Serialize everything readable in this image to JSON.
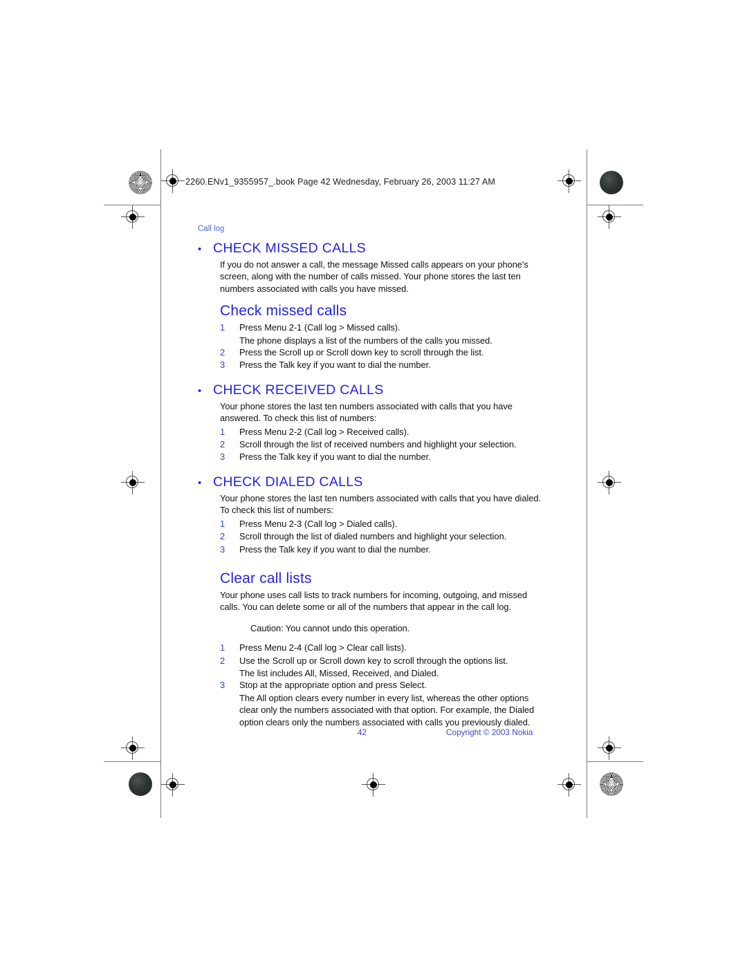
{
  "page": {
    "print_header": "2260.ENv1_9355957_.book  Page 42  Wednesday, February 26, 2003  11:27 AM",
    "running_head": "Call log",
    "bullet_glyph": "•"
  },
  "sections": [
    {
      "id": "check-missed-calls",
      "heading": "CHECK MISSED CALLS",
      "intro": [
        "If you do not answer a call, the message Missed calls appears on your phone's screen, along with the number of calls missed. Your phone stores the last ten numbers associated with calls you have missed."
      ],
      "subheading": "Check missed calls",
      "steps": [
        {
          "num": "1",
          "text": "Press Menu 2-1 (Call log > Missed calls).",
          "note": "The phone displays a list of the numbers of the calls you missed."
        },
        {
          "num": "2",
          "text": "Press the Scroll up or Scroll down key to scroll through the list.",
          "note": ""
        },
        {
          "num": "3",
          "text": "Press the Talk key if you want to dial the number.",
          "note": ""
        }
      ]
    },
    {
      "id": "check-received-calls",
      "heading": "CHECK RECEIVED CALLS",
      "intro": [
        "Your phone stores the last ten numbers associated with calls that you have answered. To check this list of numbers:"
      ],
      "subheading": "",
      "steps": [
        {
          "num": "1",
          "text": "Press Menu 2-2 (Call log > Received calls).",
          "note": ""
        },
        {
          "num": "2",
          "text": "Scroll through the list of received numbers and highlight your selection.",
          "note": ""
        },
        {
          "num": "3",
          "text": "Press the Talk key if you want to dial the number.",
          "note": ""
        }
      ]
    },
    {
      "id": "check-dialed-calls",
      "heading": "CHECK DIALED CALLS",
      "intro": [
        "Your phone stores the last ten numbers associated with calls that you have dialed. To check this list of numbers:"
      ],
      "subheading": "",
      "steps": [
        {
          "num": "1",
          "text": "Press Menu 2-3 (Call log > Dialed calls).",
          "note": ""
        },
        {
          "num": "2",
          "text": "Scroll through the list of dialed numbers and highlight your selection.",
          "note": ""
        },
        {
          "num": "3",
          "text": "Press the Talk key if you want to dial the number.",
          "note": ""
        }
      ]
    }
  ],
  "clear_call_lists": {
    "subheading": "Clear call lists",
    "intro": "Your phone uses call lists to track numbers for incoming, outgoing, and missed calls. You can delete some or all of the numbers that appear in the call log.",
    "caution": "Caution: You cannot undo this operation.",
    "steps": [
      {
        "num": "1",
        "text": "Press Menu 2-4 (Call log > Clear call lists).",
        "note": ""
      },
      {
        "num": "2",
        "text": "Use the Scroll up or Scroll down key to scroll through the options list.",
        "note": "The list includes All, Missed, Received, and Dialed."
      },
      {
        "num": "3",
        "text": "Stop at the appropriate option and press Select.",
        "note": "The All option clears every number in every list, whereas the other options clear only the numbers associated with that option. For example, the Dialed option clears only the numbers associated with calls you previously dialed."
      }
    ]
  },
  "footer": {
    "page_number": "42",
    "copyright": "Copyright © 2003 Nokia"
  },
  "colors": {
    "heading_blue": "#2323e0",
    "running_head_blue": "#5262d8",
    "step_number_blue": "#2f45cf",
    "footer_blue": "#3a4ad0",
    "body_black": "#101010"
  }
}
